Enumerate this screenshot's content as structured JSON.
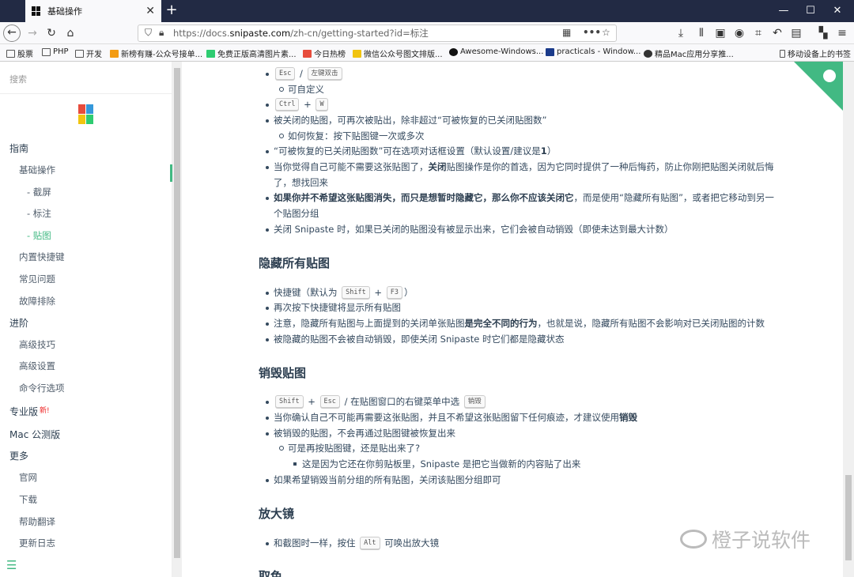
{
  "browser": {
    "tab_title": "基础操作",
    "url_prefix": "https://docs.",
    "url_domain": "snipaste.com",
    "url_suffix": "/zh-cn/getting-started?id=标注",
    "new_tab": "+",
    "close": "✕"
  },
  "bookmarks": [
    "股票",
    "PHP",
    "开发",
    "新榜有赚-公众号接单...",
    "免费正版高清图片素...",
    "今日热榜",
    "微信公众号图文排版...",
    "Awesome-Windows...",
    "practicals - Window...",
    "精品Mac应用分享推...",
    "移动设备上的书签"
  ],
  "sidebar": {
    "search": "搜索",
    "guide": "指南",
    "basic": "基础操作",
    "screenshot": "- 截屏",
    "annotate": "- 标注",
    "paste": "- 贴图",
    "shortcuts": "内置快捷键",
    "faq": "常见问题",
    "troubleshoot": "故障排除",
    "advanced": "进阶",
    "tips": "高级技巧",
    "settings": "高级设置",
    "cli": "命令行选项",
    "pro": "专业版",
    "pro_new": "新!",
    "mac": "Mac 公测版",
    "more": "更多",
    "official": "官网",
    "download": "下载",
    "translate": "帮助翻译",
    "changelog": "更新日志"
  },
  "content": {
    "k_esc": "Esc",
    "k_dbl": "左键双击",
    "slash": "/",
    "plus": "+",
    "k_ctrl": "Ctrl",
    "k_w": "W",
    "k_shift": "Shift",
    "k_f3": "F3",
    "k_alt": "Alt",
    "k_destroy": "销毁",
    "l_custom": "可自定义",
    "l_closed": "被关闭的贴图，可再次被贴出，除非超过“可被恢复的已关闭贴图数”",
    "l_restore": "如何恢复：按下贴图键一次或多次",
    "l_count": "“可被恢复的已关闭贴图数”可在选项对话框设置（默认设置/建议是 ",
    "l_count_b": "1",
    "l_count_end": "）",
    "l_when_a": "当你觉得自己可能不需要这张贴图了，",
    "l_when_b": "关闭",
    "l_when_c": "贴图操作是你的首选，因为它同时提供了一种后悔药，防止你刚把贴图关闭就后悔",
    "l_when_d": "了，想找回来",
    "l_hide_b": "如果你并不希望这张贴图消失，而只是想暂时隐藏它，那么你不应该关闭它",
    "l_hide_c": "，而是使用“隐藏所有贴图”，或者把它移动到另一",
    "l_hide_d": "个贴图分组",
    "l_exit": "关闭 Snipaste 时，如果已关闭的贴图没有被显示出来，它们会被自动销毁（即使未达到最大计数）",
    "h_hide": "隐藏所有贴图",
    "l_hk_a": "快捷键（默认为",
    "l_hk_end": "）",
    "l_again": "再次按下快捷键将显示所有贴图",
    "l_note_a": "注意，隐藏所有贴图与上面提到的关闭单张贴图",
    "l_note_b": "是完全不同的行为",
    "l_note_c": "，也就是说，隐藏所有贴图不会影响对已关闭贴图的计数",
    "l_hidden": "被隐藏的贴图不会被自动销毁，即使关闭 Snipaste 时它们都是隐藏状态",
    "h_destroy": "销毁贴图",
    "l_menu": "/ 在贴图窗口的右键菜单中选",
    "l_sure_a": "当你确认自己不可能再需要这张贴图，并且不希望这张贴图留下任何痕迹，才建议使用",
    "l_sure_b": "销毁",
    "l_cannot": "被销毁的贴图，不会再通过贴图键被恢复出来",
    "l_still": "可是再按贴图键，还是贴出来了?",
    "l_because": "这是因为它还在你剪贴板里，Snipaste 是把它当做新的内容贴了出来",
    "l_group": "如果希望销毁当前分组的所有贴图，关闭该贴图分组即可",
    "h_mag": "放大镜",
    "l_mag_a": "和截图时一样，按住",
    "l_mag_b": "可唤出放大镜",
    "h_next": "取色",
    "watermark": "橙子说软件"
  }
}
